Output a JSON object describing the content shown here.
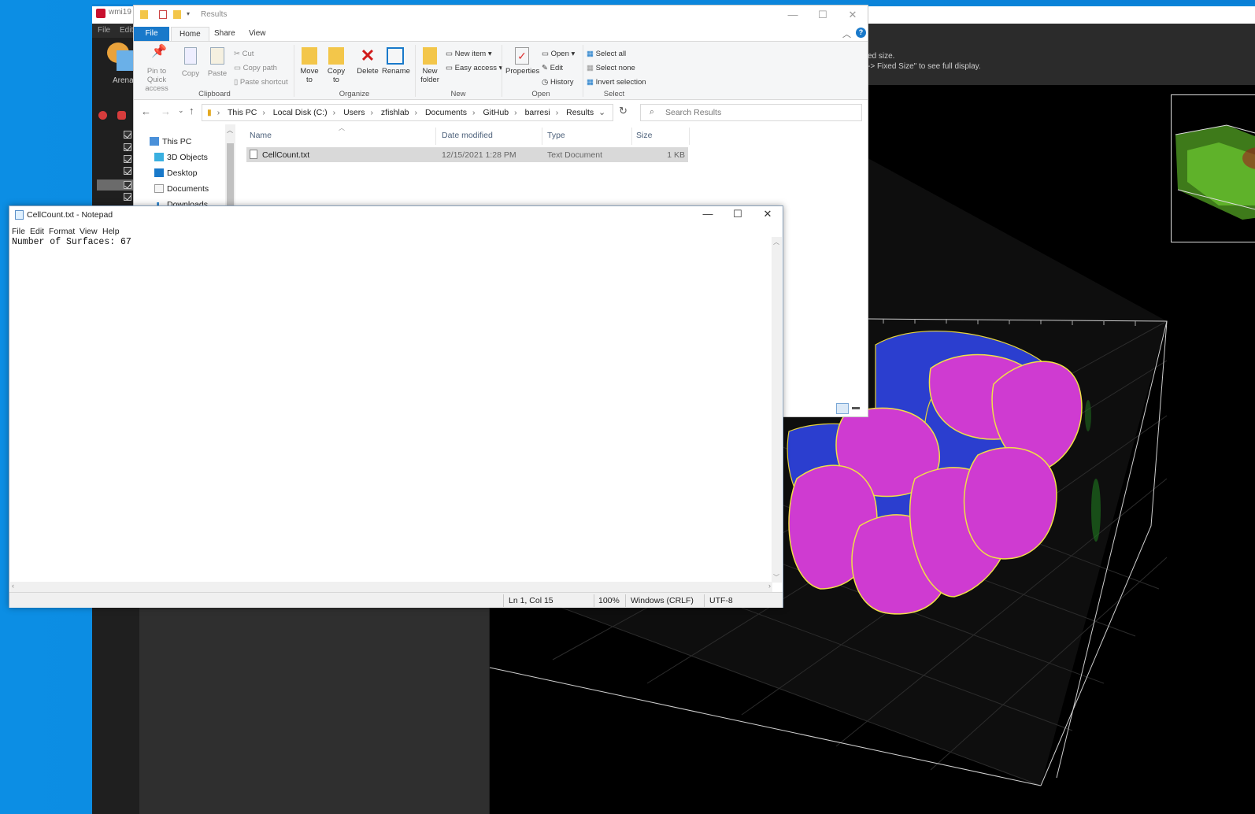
{
  "imaris": {
    "title": "wmi19",
    "menu": [
      "File",
      "Edit"
    ],
    "arena_label": "Arena",
    "note_line1": "ed size.",
    "note_line2": "-> Fixed Size\" to see full display."
  },
  "explorer": {
    "title": "Results",
    "tabs": [
      "File",
      "Home",
      "Share",
      "View"
    ],
    "ribbon": {
      "clipboard": {
        "pin": "Pin to Quick access",
        "copy": "Copy",
        "paste": "Paste",
        "cut": "Cut",
        "copy_path": "Copy path",
        "paste_shortcut": "Paste shortcut",
        "group": "Clipboard"
      },
      "organize": {
        "move_to": "Move to",
        "copy_to": "Copy to",
        "delete": "Delete",
        "rename": "Rename",
        "group": "Organize"
      },
      "new": {
        "new_folder": "New folder",
        "new_item": "New item",
        "easy_access": "Easy access",
        "group": "New"
      },
      "open": {
        "properties": "Properties",
        "open": "Open",
        "edit": "Edit",
        "history": "History",
        "group": "Open"
      },
      "select": {
        "select_all": "Select all",
        "select_none": "Select none",
        "invert": "Invert selection",
        "group": "Select"
      }
    },
    "breadcrumb": [
      "This PC",
      "Local Disk (C:)",
      "Users",
      "zfishlab",
      "Documents",
      "GitHub",
      "barresi",
      "Results"
    ],
    "search_placeholder": "Search Results",
    "nav": [
      "This PC",
      "3D Objects",
      "Desktop",
      "Documents",
      "Downloads"
    ],
    "columns": [
      "Name",
      "Date modified",
      "Type",
      "Size"
    ],
    "files": [
      {
        "name": "CellCount.txt",
        "modified": "12/15/2021 1:28 PM",
        "type": "Text Document",
        "size": "1 KB"
      }
    ]
  },
  "notepad": {
    "title": "CellCount.txt - Notepad",
    "menu": [
      "File",
      "Edit",
      "Format",
      "View",
      "Help"
    ],
    "content": "Number of Surfaces: 67",
    "status": {
      "position": "Ln 1, Col 15",
      "zoom": "100%",
      "line_ending": "Windows (CRLF)",
      "encoding": "UTF-8"
    }
  }
}
